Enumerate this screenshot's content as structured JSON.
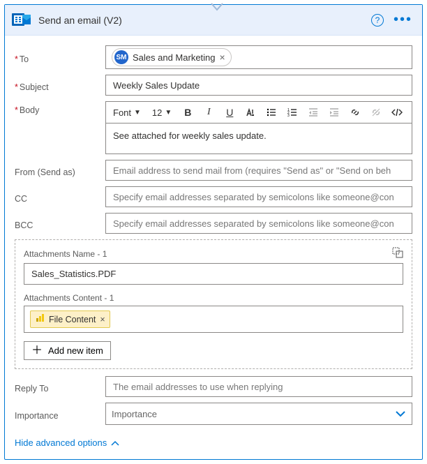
{
  "header": {
    "title": "Send an email (V2)"
  },
  "fields": {
    "to": {
      "label": "To",
      "chip_initials": "SM",
      "chip_text": "Sales and Marketing"
    },
    "subject": {
      "label": "Subject",
      "value": "Weekly Sales Update"
    },
    "body": {
      "label": "Body",
      "font_label": "Font",
      "size_label": "12",
      "content": "See attached for weekly sales update."
    },
    "from": {
      "label": "From (Send as)",
      "placeholder": "Email address to send mail from (requires \"Send as\" or \"Send on beh"
    },
    "cc": {
      "label": "CC",
      "placeholder": "Specify email addresses separated by semicolons like someone@con"
    },
    "bcc": {
      "label": "BCC",
      "placeholder": "Specify email addresses separated by semicolons like someone@con"
    },
    "reply_to": {
      "label": "Reply To",
      "placeholder": "The email addresses to use when replying"
    },
    "importance": {
      "label": "Importance",
      "placeholder": "Importance"
    }
  },
  "attachments": {
    "name_label": "Attachments Name - 1",
    "name_value": "Sales_Statistics.PDF",
    "content_label": "Attachments Content - 1",
    "token_text": "File Content",
    "add_label": "Add new item"
  },
  "footer": {
    "hide_advanced": "Hide advanced options"
  }
}
